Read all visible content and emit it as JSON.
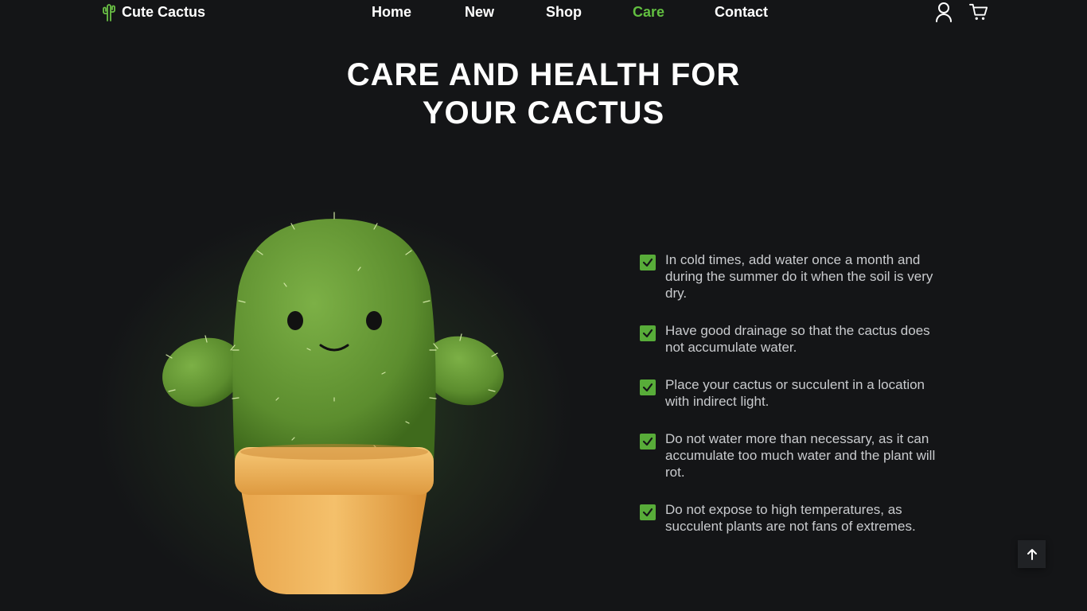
{
  "header": {
    "logo_text": "Cute Cactus",
    "nav": [
      {
        "label": "Home",
        "active": false
      },
      {
        "label": "New",
        "active": false
      },
      {
        "label": "Shop",
        "active": false
      },
      {
        "label": "Care",
        "active": true
      },
      {
        "label": "Contact",
        "active": false
      }
    ],
    "icons": [
      "user-icon",
      "cart-icon"
    ]
  },
  "care": {
    "title": "Care and health for your cactus",
    "items": [
      "In cold times, add water once a month and during the summer do it when the soil is very dry.",
      "Have good drainage so that the cactus does not accumulate water.",
      "Place your cactus or succulent in a location with indirect light.",
      "Do not water more than necessary, as it can accumulate too much water and the plant will rot.",
      "Do not expose to high temperatures, as succulent plants are not fans of extremes."
    ]
  },
  "colors": {
    "background": "#141517",
    "accent_green": "#6ac045",
    "text_muted": "#c9cbce"
  }
}
